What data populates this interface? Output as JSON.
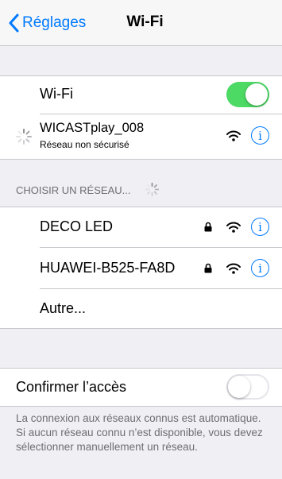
{
  "navbar": {
    "back_label": "Réglages",
    "title": "Wi-Fi"
  },
  "wifi": {
    "label": "Wi-Fi",
    "enabled": true,
    "current_network": {
      "name": "WICASTplay_008",
      "status": "Réseau non sécurisé"
    }
  },
  "choose_network": {
    "header": "CHOISIR UN RÉSEAU...",
    "networks": [
      {
        "name": "DECO LED",
        "locked": true
      },
      {
        "name": "HUAWEI-B525-FA8D",
        "locked": true
      }
    ],
    "other_label": "Autre..."
  },
  "ask_to_join": {
    "label": "Confirmer l’accès",
    "enabled": false,
    "footer": "La connexion aux réseaux connus est automatique. Si aucun réseau connu n’est disponible, vous devez sélectionner manuellement un réseau."
  },
  "colors": {
    "accent": "#007aff",
    "toggle_on": "#4cd964",
    "background": "#efeff4"
  },
  "icons": {
    "back": "chevron-left-icon",
    "spinner": "activity-spinner-icon",
    "wifi": "wifi-icon",
    "lock": "lock-icon",
    "info": "info-icon"
  }
}
